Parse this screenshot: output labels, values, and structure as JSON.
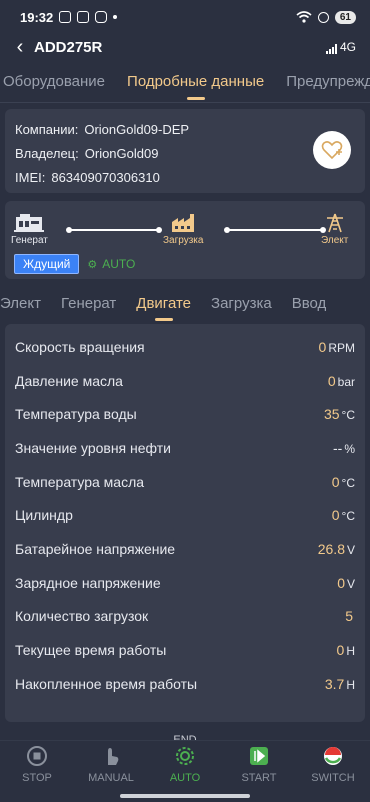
{
  "status_bar": {
    "time": "19:32",
    "battery": "61",
    "network": "4G"
  },
  "header": {
    "title": "ADD275R"
  },
  "tabs": [
    "Оборудование",
    "Подробные данные",
    "Предупрежде"
  ],
  "info": {
    "company_label": "Компании:",
    "company_value": "OrionGold09-DEP",
    "owner_label": "Владелец:",
    "owner_value": "OrionGold09",
    "imei_label": "IMEI:",
    "imei_value": "863409070306310"
  },
  "flow": {
    "generator": "Генерат",
    "load": "Загрузка",
    "electric": "Элект",
    "state_badge": "Ждущий",
    "mode": "AUTO"
  },
  "subtabs": [
    "Элект",
    "Генерат",
    "Двигате",
    "Загрузка",
    "Ввод"
  ],
  "params": [
    {
      "name": "Скорость вращения",
      "value": "0",
      "unit": "RPM"
    },
    {
      "name": "Давление масла",
      "value": "0",
      "unit": "bar"
    },
    {
      "name": "Температура воды",
      "value": "35",
      "unit": "°C"
    },
    {
      "name": "Значение уровня нефти",
      "value": "--",
      "unit": "%"
    },
    {
      "name": "Температура масла",
      "value": "0",
      "unit": "°C"
    },
    {
      "name": "Цилиндр",
      "value": "0",
      "unit": "°C"
    },
    {
      "name": "Батарейное напряжение",
      "value": "26.8",
      "unit": "V"
    },
    {
      "name": "Зарядное напряжение",
      "value": "0",
      "unit": "V"
    },
    {
      "name": "Количество загрузок",
      "value": "5",
      "unit": ""
    },
    {
      "name": "Текущее время работы",
      "value": "0",
      "unit": "H"
    },
    {
      "name": "Накопленное время работы",
      "value": "3.7",
      "unit": "H"
    }
  ],
  "end_text": "END",
  "bottom_nav": [
    {
      "label": "STOP",
      "icon": "stop-icon"
    },
    {
      "label": "MANUAL",
      "icon": "hand-icon"
    },
    {
      "label": "AUTO",
      "icon": "auto-gear-icon"
    },
    {
      "label": "START",
      "icon": "start-icon"
    },
    {
      "label": "SWITCH",
      "icon": "switch-icon"
    }
  ],
  "colors": {
    "accent": "#f2c98b",
    "auto_green": "#4caf50",
    "badge_blue": "#3b82f6",
    "background": "#2b3040",
    "card": "#383d4d"
  }
}
